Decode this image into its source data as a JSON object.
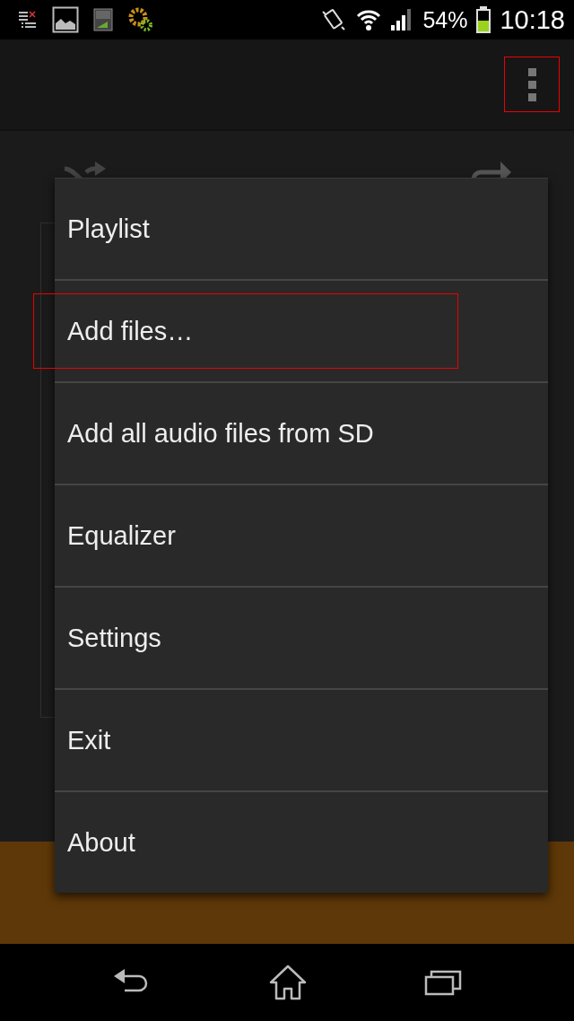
{
  "status_bar": {
    "battery_percent": "54%",
    "time": "10:18",
    "battery": {
      "level": 0.54
    }
  },
  "app_bar": {
    "overflow_highlighted": true
  },
  "menu": {
    "items": [
      {
        "label": "Playlist",
        "highlighted": false
      },
      {
        "label": "Add files…",
        "highlighted": true
      },
      {
        "label": "Add all audio files from SD",
        "highlighted": false
      },
      {
        "label": "Equalizer",
        "highlighted": false
      },
      {
        "label": "Settings",
        "highlighted": false
      },
      {
        "label": "Exit",
        "highlighted": false
      },
      {
        "label": "About",
        "highlighted": false
      }
    ]
  }
}
